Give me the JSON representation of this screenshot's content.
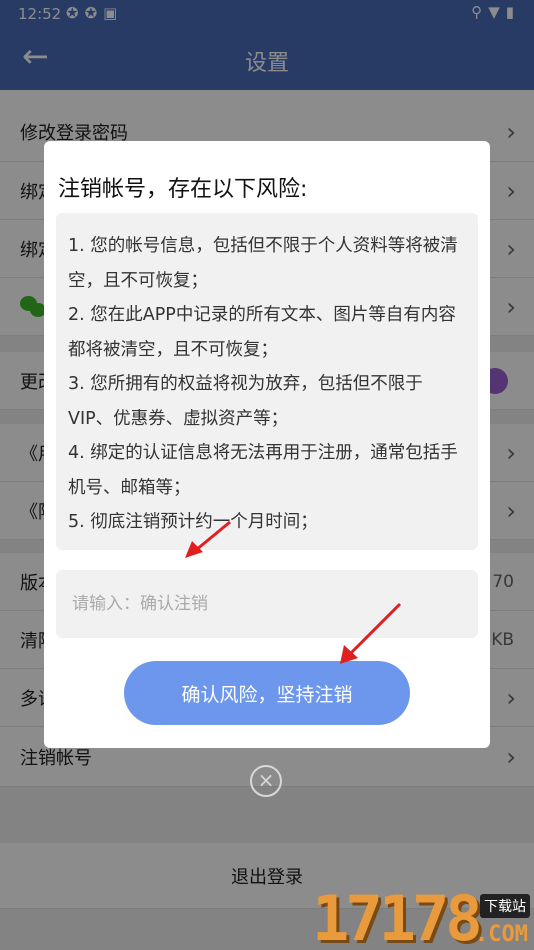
{
  "status_bar": {
    "time": "12:52",
    "left_icons": "✪✪▣",
    "right_icons": "⚲▼▮"
  },
  "header": {
    "title": "设置",
    "back_icon": "←"
  },
  "settings": {
    "change_password": "修改登录密码",
    "bind_1": "绑定",
    "bind_2": "绑定",
    "change_3": "更改",
    "agreement_1": "《用",
    "agreement_2": "《隐",
    "version_label": "版本",
    "version_value": "70",
    "clear_label": "清除",
    "clear_value": "KB",
    "multi_label": "多语",
    "delete_account": "注销帐号",
    "logout": "退出登录",
    "chevron": "›"
  },
  "dialog": {
    "title": "注销帐号，存在以下风险:",
    "risks": [
      "1. 您的帐号信息，包括但不限于个人资料等将被清空，且不可恢复；",
      "2. 您在此APP中记录的所有文本、图片等自有内容都将被清空，且不可恢复；",
      "3. 您所拥有的权益将视为放弃，包括但不限于VIP、优惠券、虚拟资产等；",
      "4. 绑定的认证信息将无法再用于注册，通常包括手机号、邮箱等；",
      "5. 彻底注销预计约一个月时间；"
    ],
    "input_placeholder": "请输入：确认注销",
    "input_value": "",
    "confirm_label": "确认风险，坚持注销",
    "close_icon": "×"
  },
  "watermark": {
    "digits": "17178",
    "tag": "下载站",
    "com": ".COM"
  },
  "colors": {
    "header": "#4a6cb8",
    "button": "#6d97ec",
    "arrow": "#e02020",
    "toggle": "#9a5fd0"
  }
}
